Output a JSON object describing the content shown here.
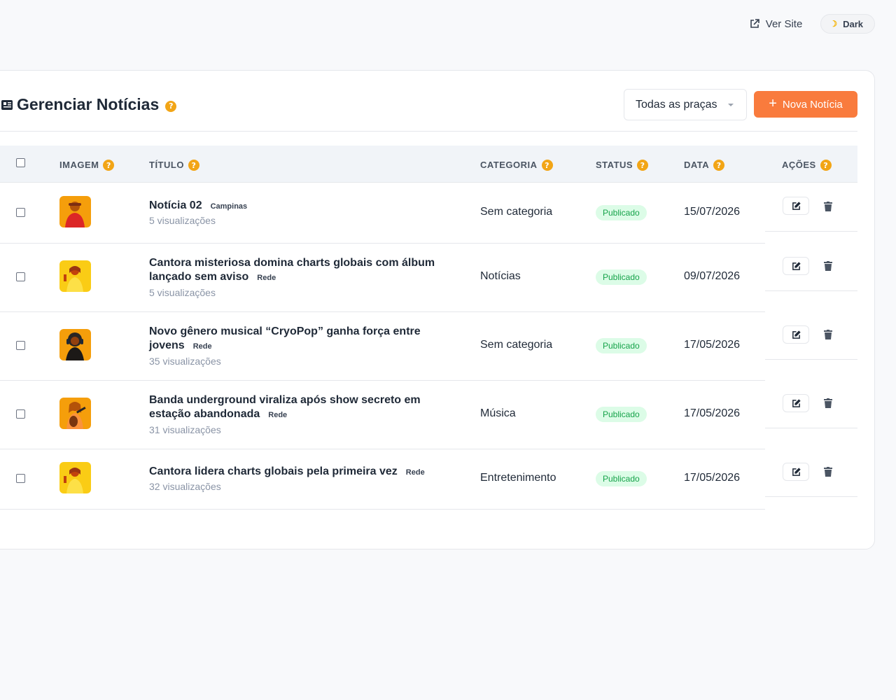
{
  "topbar": {
    "ver_site_label": "Ver Site",
    "dark_label": "Dark"
  },
  "header": {
    "title": "Gerenciar Notícias",
    "help": "?",
    "filter_selected": "Todas as praças",
    "new_button_label": "Nova Notícia"
  },
  "table": {
    "columns": [
      {
        "label": "IMAGEM",
        "help": "?"
      },
      {
        "label": "TÍTULO",
        "help": "?"
      },
      {
        "label": "CATEGORIA",
        "help": "?"
      },
      {
        "label": "STATUS",
        "help": "?"
      },
      {
        "label": "DATA",
        "help": "?"
      },
      {
        "label": "AÇÕES",
        "help": "?"
      }
    ],
    "rows": [
      {
        "title": "Notícia 02",
        "tag": "Campinas",
        "views": "5 visualizações",
        "category": "Sem categoria",
        "status": "Publicado",
        "date": "15/07/2026",
        "thumb_bg": "#f59e0b"
      },
      {
        "title": "Cantora misteriosa domina charts globais com álbum lançado sem aviso",
        "tag": "Rede",
        "views": "5 visualizações",
        "category": "Notícias",
        "status": "Publicado",
        "date": "09/07/2026",
        "thumb_bg": "#facc15"
      },
      {
        "title": "Novo gênero musical “CryoPop” ganha força entre jovens",
        "tag": "Rede",
        "views": "35 visualizações",
        "category": "Sem categoria",
        "status": "Publicado",
        "date": "17/05/2026",
        "thumb_bg": "#f59e0b"
      },
      {
        "title": "Banda underground viraliza após show secreto em estação abandonada",
        "tag": "Rede",
        "views": "31 visualizações",
        "category": "Música",
        "status": "Publicado",
        "date": "17/05/2026",
        "thumb_bg": "#f59e0b"
      },
      {
        "title": "Cantora lidera charts globais pela primeira vez",
        "tag": "Rede",
        "views": "32 visualizações",
        "category": "Entretenimento",
        "status": "Publicado",
        "date": "17/05/2026",
        "thumb_bg": "#facc15"
      }
    ]
  },
  "colors": {
    "accent": "#f97b3d",
    "help_badge": "#f2a516",
    "status_bg": "#dcfce7",
    "status_text": "#16a34a"
  }
}
